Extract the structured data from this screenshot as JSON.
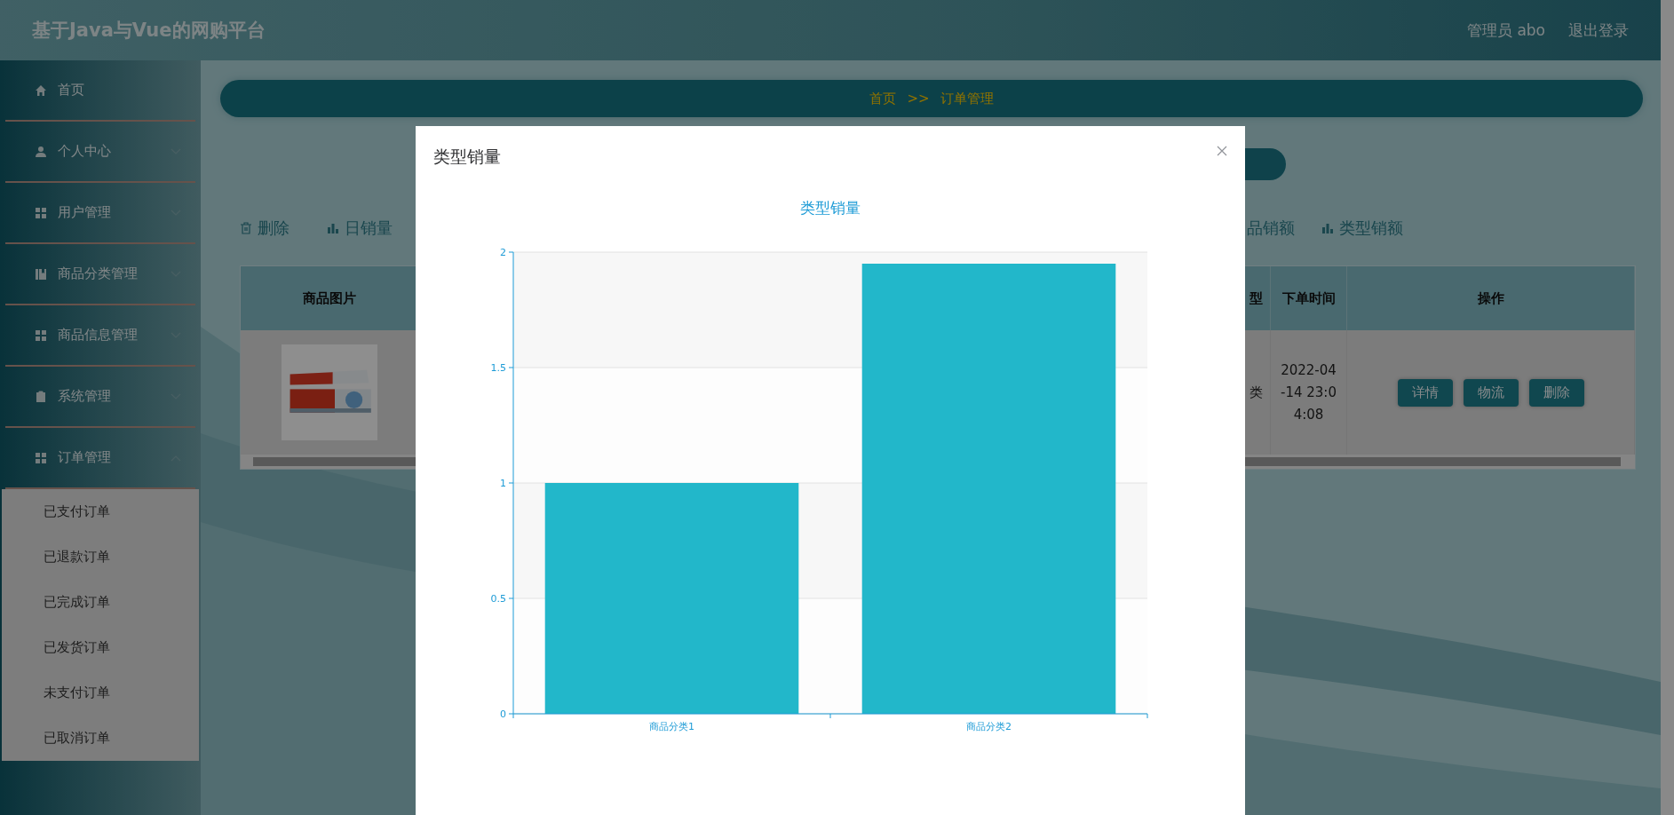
{
  "header": {
    "title": "基于Java与Vue的网购平台",
    "user": "管理员 abo",
    "logout": "退出登录"
  },
  "sidebar": {
    "items": [
      {
        "label": "首页",
        "kind": "home"
      },
      {
        "label": "个人中心",
        "kind": "user",
        "expanded": false
      },
      {
        "label": "用户管理",
        "kind": "grid",
        "expanded": false
      },
      {
        "label": "商品分类管理",
        "kind": "book",
        "expanded": false
      },
      {
        "label": "商品信息管理",
        "kind": "grid",
        "expanded": false
      },
      {
        "label": "系统管理",
        "kind": "clipboard",
        "expanded": false
      },
      {
        "label": "订单管理",
        "kind": "grid",
        "expanded": true,
        "children": [
          {
            "label": "已支付订单"
          },
          {
            "label": "已退款订单"
          },
          {
            "label": "已完成订单"
          },
          {
            "label": "已发货订单"
          },
          {
            "label": "未支付订单"
          },
          {
            "label": "已取消订单"
          }
        ]
      }
    ]
  },
  "breadcrumb": [
    "首页",
    ">>",
    "订单管理"
  ],
  "toolbar_left": [
    {
      "label": "删除",
      "kind": "trash"
    },
    {
      "label": "日销量",
      "kind": "bar"
    }
  ],
  "toolbar_right": [
    {
      "label": "品销额",
      "kind": "text"
    },
    {
      "label": "类型销额",
      "kind": "bar"
    }
  ],
  "table": {
    "columns_left": [
      "商品图片"
    ],
    "columns_right": [
      "型",
      "下单时间",
      "操作"
    ],
    "row": {
      "cell_type": "类",
      "time": "2022-04-14 23:04:08",
      "actions": [
        "详情",
        "物流",
        "删除"
      ]
    }
  },
  "modal": {
    "title": "类型销量",
    "chart_data": {
      "type": "bar",
      "title": "类型销量",
      "categories": [
        "商品分类1",
        "商品分类2"
      ],
      "series": [
        {
          "color": "#22b7ca",
          "values": [
            1,
            1.95
          ]
        }
      ],
      "ylim": [
        0,
        2
      ],
      "yticks": [
        0,
        0.5,
        1,
        1.5,
        2
      ],
      "grid": true
    }
  }
}
